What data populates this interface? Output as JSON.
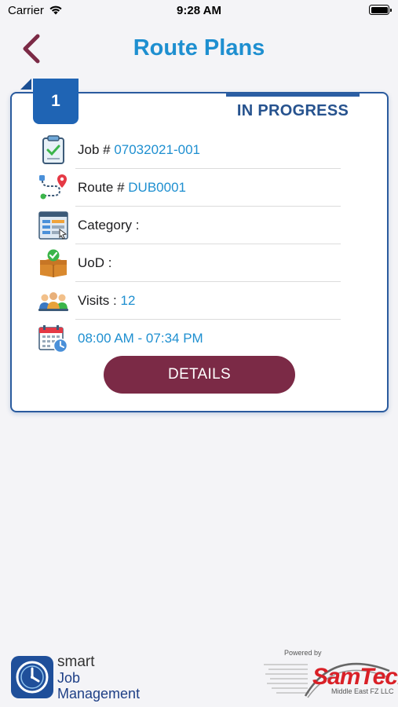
{
  "status_bar": {
    "carrier": "Carrier",
    "time": "9:28 AM"
  },
  "header": {
    "title": "Route Plans"
  },
  "card": {
    "number": "1",
    "status": "IN PROGRESS",
    "rows": [
      {
        "icon": "clipboard-check-icon",
        "label": "Job # ",
        "value": "07032021-001"
      },
      {
        "icon": "route-pin-icon",
        "label": "Route # ",
        "value": "DUB0001"
      },
      {
        "icon": "category-list-icon",
        "label": "Category :",
        "value": ""
      },
      {
        "icon": "box-check-icon",
        "label": "UoD :",
        "value": ""
      },
      {
        "icon": "visitors-group-icon",
        "label": "Visits : ",
        "value": "12"
      },
      {
        "icon": "calendar-clock-icon",
        "label": "",
        "value": "08:00 AM - 07:34 PM"
      }
    ],
    "details_label": "DETAILS"
  },
  "footer": {
    "app_name_1": "smart",
    "app_name_2": "Job",
    "app_name_3": "Management",
    "powered_by": "Powered by",
    "brand": "SamTech",
    "brand_sub": "Middle East FZ LLC"
  },
  "colors": {
    "accent_blue": "#1e8fd0",
    "card_border": "#2a5b9e",
    "button": "#7b2a46"
  }
}
